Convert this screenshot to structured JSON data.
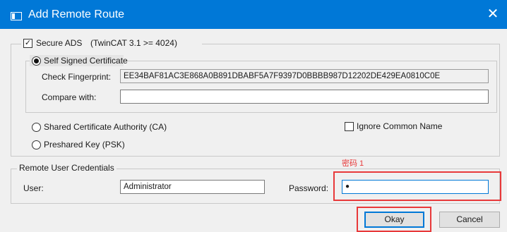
{
  "window": {
    "title": "Add Remote Route",
    "close_glyph": "✕",
    "icon": "app-window-icon"
  },
  "secure_ads": {
    "checked": true,
    "check_glyph": "✓",
    "label": "Secure ADS",
    "note": "(TwinCAT 3.1 >= 4024)"
  },
  "self_signed": {
    "label": "Self Signed Certificate",
    "selected": true,
    "fingerprint_label": "Check Fingerprint:",
    "fingerprint_value": "EE34BAF81AC3E868A0B891DBABF5A7F9397D0BBBB987D12202DE429EA0810C0E",
    "compare_label": "Compare with:",
    "compare_value": ""
  },
  "shared_ca": {
    "label": "Shared Certificate Authority (CA)",
    "selected": false
  },
  "psk": {
    "label": "Preshared Key (PSK)",
    "selected": false
  },
  "ignore_common_name": {
    "label": "Ignore Common Name",
    "checked": false
  },
  "credentials": {
    "group_label": "Remote User Credentials",
    "user_label": "User:",
    "user_value": "Administrator",
    "password_label": "Password:",
    "password_value": "●",
    "annotation": "密码 1"
  },
  "buttons": {
    "okay": "Okay",
    "cancel": "Cancel"
  },
  "colors": {
    "titlebar": "#0078d7",
    "annotation_red": "#e8393a"
  }
}
